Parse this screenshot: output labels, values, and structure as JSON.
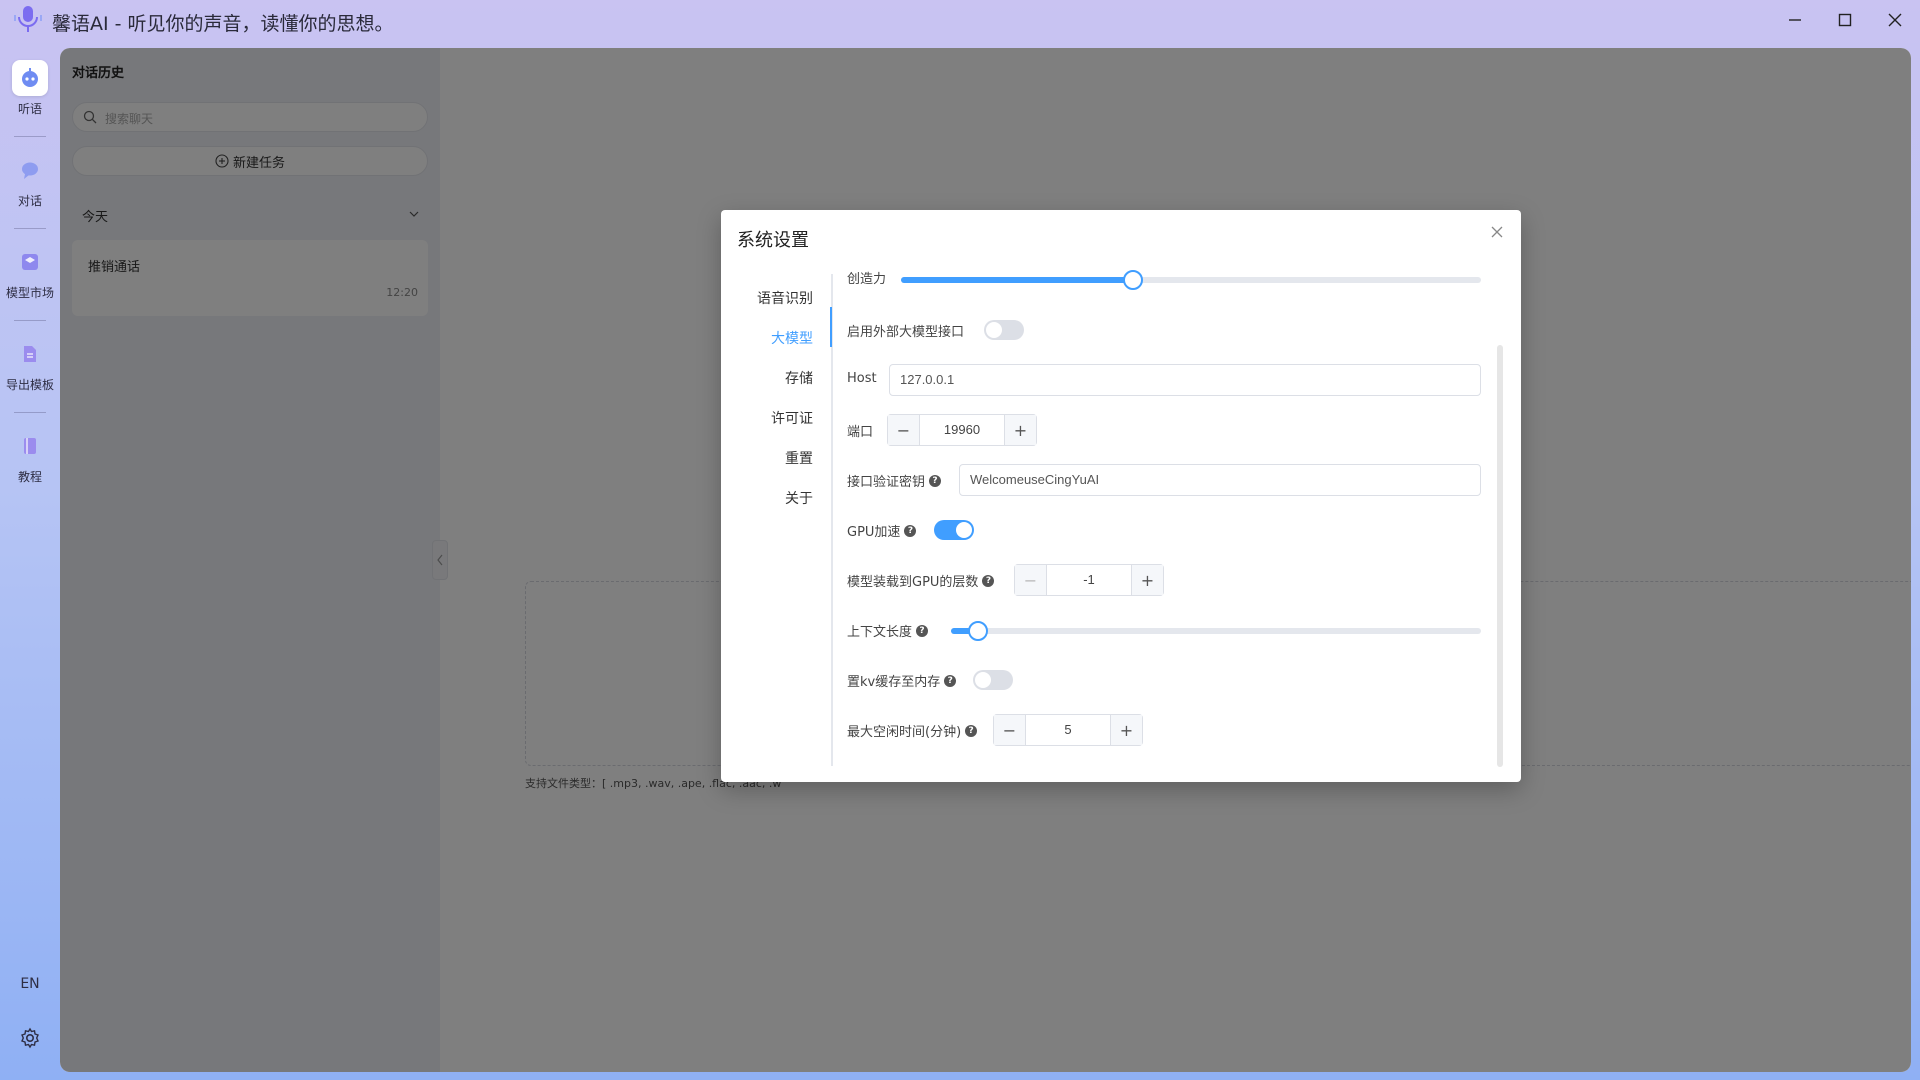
{
  "app": {
    "title": "馨语AI - 听见你的声音，读懂你的思想。",
    "logo_icon": "microphone-logo-icon"
  },
  "window_controls": {
    "minimize_icon": "minimize-icon",
    "maximize_icon": "maximize-icon",
    "close_icon": "close-icon"
  },
  "rail": {
    "items": [
      {
        "label": "听语",
        "icon": "robot-icon",
        "active": true
      },
      {
        "label": "对话",
        "icon": "chat-bubble-icon",
        "active": false
      },
      {
        "label": "模型市场",
        "icon": "cube-icon",
        "active": false
      },
      {
        "label": "导出模板",
        "icon": "document-icon",
        "active": false
      },
      {
        "label": "教程",
        "icon": "book-icon",
        "active": false
      }
    ],
    "language": "EN",
    "settings_icon": "gear-icon"
  },
  "history": {
    "title": "对话历史",
    "search_placeholder": "搜索聊天",
    "new_task_label": "新建任务",
    "group_label": "今天",
    "conversations": [
      {
        "title": "推销通话",
        "time": "12:20"
      }
    ]
  },
  "content": {
    "file_types_text": "支持文件类型：[ .mp3, .wav, .ape, .flac, .aac, .w"
  },
  "dialog": {
    "title": "系统设置",
    "nav": [
      {
        "label": "语音识别",
        "active": false
      },
      {
        "label": "大模型",
        "active": true
      },
      {
        "label": "存储",
        "active": false
      },
      {
        "label": "许可证",
        "active": false
      },
      {
        "label": "重置",
        "active": false
      },
      {
        "label": "关于",
        "active": false
      }
    ],
    "settings": {
      "creativity": {
        "label": "创造力",
        "value_fraction": 0.4
      },
      "external_llm": {
        "label": "启用外部大模型接口",
        "enabled": false
      },
      "host": {
        "label": "Host",
        "value": "127.0.0.1"
      },
      "port": {
        "label": "端口",
        "value": "19960",
        "dec": "−",
        "inc": "+"
      },
      "api_key": {
        "label": "接口验证密钥",
        "value": "WelcomeuseCingYuAI"
      },
      "gpu_accel": {
        "label": "GPU加速",
        "enabled": true
      },
      "gpu_layers": {
        "label": "模型装载到GPU的层数",
        "value": "-1",
        "dec": "−",
        "inc": "+"
      },
      "context_length": {
        "label": "上下文长度",
        "value_fraction": 0.05
      },
      "kv_cache_memory": {
        "label": "置kv缓存至内存",
        "enabled": false
      },
      "max_idle": {
        "label": "最大空闲时间(分钟)",
        "value": "5",
        "dec": "−",
        "inc": "+"
      }
    },
    "help_glyph": "?"
  },
  "colors": {
    "accent": "#409eff",
    "overlay": "rgba(0,0,0,0.5)"
  }
}
